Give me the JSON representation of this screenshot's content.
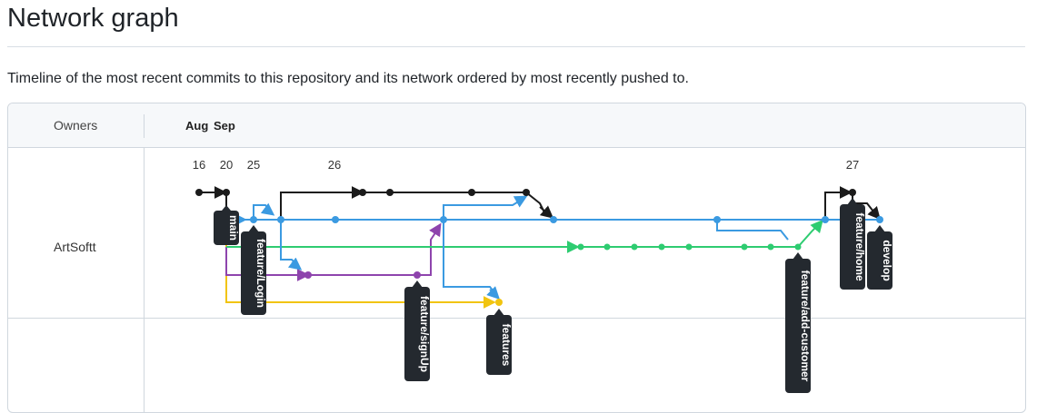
{
  "page": {
    "title": "Network graph",
    "description": "Timeline of the most recent commits to this repository and its network ordered by most recently pushed to."
  },
  "graph": {
    "owners_header": "Owners",
    "months": [
      "Aug",
      "Sep"
    ],
    "days": [
      "16",
      "20",
      "25",
      "26",
      "27"
    ],
    "owner": "ArtSoftt",
    "branches": [
      "main",
      "feature/Login",
      "feature/signUp",
      "features",
      "feature/add-customer",
      "feature/home",
      "develop"
    ],
    "colors": {
      "black": "#1b1b1b",
      "blue": "#3b9ae1",
      "green": "#2ecc71",
      "purple": "#8e44ad",
      "yellow": "#f1c40f",
      "label_bg": "#24292f",
      "label_text": "#ffffff"
    }
  }
}
